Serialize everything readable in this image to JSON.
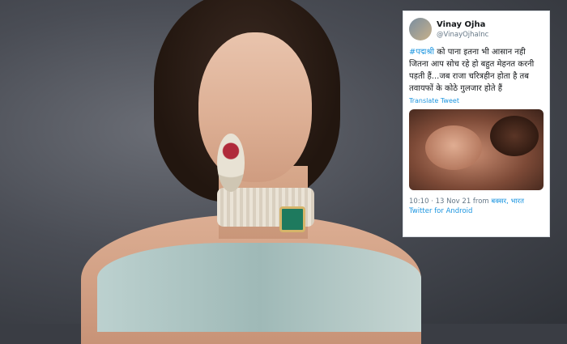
{
  "tweet": {
    "name": "Vinay Ojha",
    "handle": "@VinayOjhaInc",
    "hashtag": "#पद्मश्री",
    "text": " को पाना इतना भी आसान नही जितना आप सोच रहे हो बहुत मेहनत करनी पड़ती हैं...जब राजा चरित्रहीन होता है तब तवायफों के कोठे गुलजार होते हैं",
    "translate": "Translate Tweet",
    "time": "10:10 · 13 Nov 21 from ",
    "place": "बक्सर, भारत",
    "source": "Twitter for Android"
  }
}
